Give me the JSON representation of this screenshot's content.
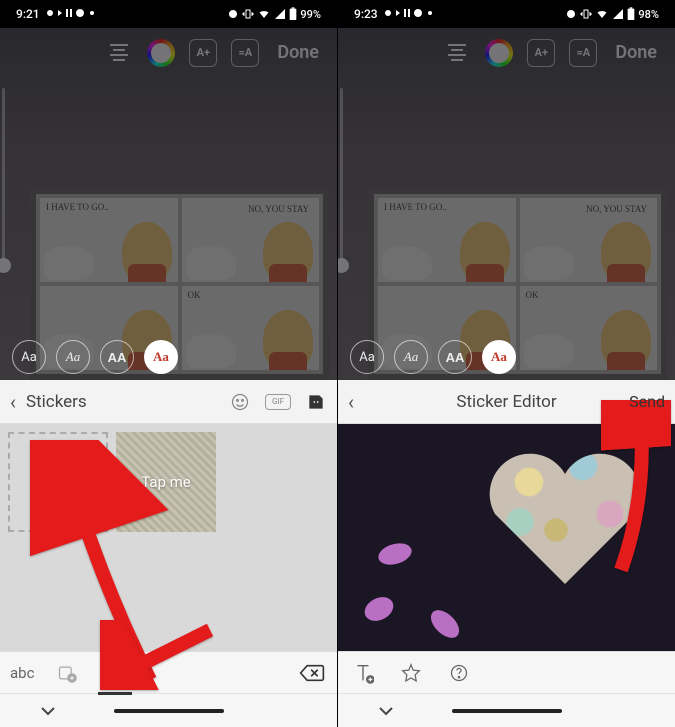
{
  "left": {
    "status": {
      "time": "9:21",
      "battery": "99%"
    },
    "toolbar": {
      "done": "Done",
      "aplus": "A+",
      "eqA": "=A"
    },
    "comic": {
      "p1": "I HAVE TO GO..",
      "p2": "NO, YOU STAY",
      "p4": "OK"
    },
    "fonts": {
      "f1": "Aa",
      "f2": "Aa",
      "f3": "AA",
      "f4": "Aa"
    },
    "panel": {
      "title": "Stickers",
      "sample": "Tap me",
      "tabs": {
        "abc": "abc"
      }
    }
  },
  "right": {
    "status": {
      "time": "9:23",
      "battery": "98%"
    },
    "toolbar": {
      "done": "Done",
      "aplus": "A+",
      "eqA": "=A"
    },
    "comic": {
      "p1": "I HAVE TO GO..",
      "p2": "NO, YOU STAY",
      "p4": "OK"
    },
    "fonts": {
      "f1": "Aa",
      "f2": "Aa",
      "f3": "AA",
      "f4": "Aa"
    },
    "panel": {
      "title": "Sticker Editor",
      "send": "Send"
    }
  }
}
